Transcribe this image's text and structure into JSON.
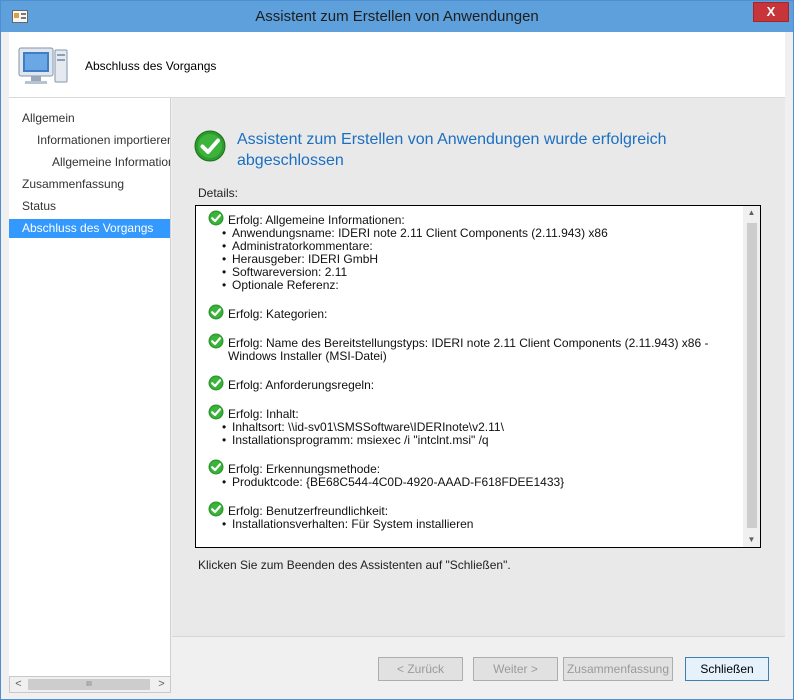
{
  "window": {
    "title": "Assistent zum Erstellen von Anwendungen",
    "close_label": "X"
  },
  "header": {
    "title": "Abschluss des Vorgangs"
  },
  "nav": {
    "items": [
      {
        "label": "Allgemein",
        "active": false
      },
      {
        "label": "Informationen importieren",
        "active": false
      },
      {
        "label": "Allgemeine Informationen",
        "active": false
      },
      {
        "label": "Zusammenfassung",
        "active": false
      },
      {
        "label": "Status",
        "active": false
      },
      {
        "label": "Abschluss des Vorgangs",
        "active": true
      }
    ],
    "scroll_left": "<",
    "scroll_right": ">",
    "scroll_grip": "III"
  },
  "main": {
    "success_line1": "Assistent zum Erstellen von Anwendungen wurde erfolgreich",
    "success_line2": "abgeschlossen",
    "details_label": "Details:",
    "hint": "Klicken Sie zum Beenden des Assistenten auf \"Schließen\"."
  },
  "details": [
    {
      "heading": "Erfolg: Allgemeine Informationen:",
      "lines": [
        "Anwendungsname: IDERI note 2.11 Client Components (2.11.943) x86",
        "Administratorkommentare:",
        "Herausgeber: IDERI GmbH",
        "Softwareversion: 2.11",
        "Optionale Referenz:"
      ]
    },
    {
      "heading": "Erfolg: Kategorien:",
      "lines": []
    },
    {
      "heading": "Erfolg: Name des Bereitstellungstyps: IDERI note 2.11 Client Components (2.11.943) x86 - Windows Installer (MSI-Datei)",
      "lines": []
    },
    {
      "heading": "Erfolg: Anforderungsregeln:",
      "lines": []
    },
    {
      "heading": "Erfolg: Inhalt:",
      "lines": [
        "Inhaltsort: \\\\id-sv01\\SMSSoftware\\IDERInote\\v2.11\\",
        "Installationsprogramm: msiexec /i \"intclnt.msi\" /q"
      ]
    },
    {
      "heading": "Erfolg: Erkennungsmethode:",
      "lines": [
        "Produktcode: {BE68C544-4C0D-4920-AAAD-F618FDEE1433}"
      ]
    },
    {
      "heading": "Erfolg: Benutzerfreundlichkeit:",
      "lines": [
        "Installationsverhalten: Für System installieren"
      ]
    }
  ],
  "buttons": {
    "back": "< Zurück",
    "next": "Weiter >",
    "summary": "Zusammenfassung",
    "close": "Schließen"
  },
  "colors": {
    "title_bar": "#5da0dc",
    "accent_text": "#1b6fc1",
    "nav_active": "#3399ff",
    "success_green": "#2e9b2e"
  }
}
